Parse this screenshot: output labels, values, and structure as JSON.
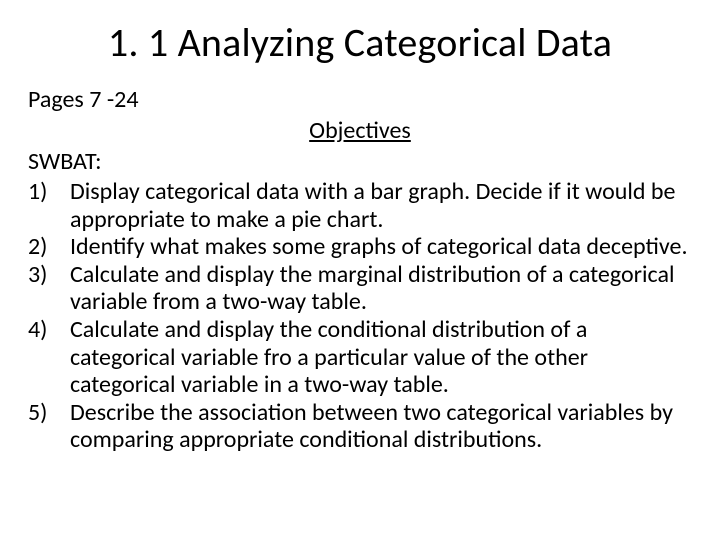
{
  "title": "1. 1 Analyzing Categorical Data",
  "pages": "Pages 7 -24",
  "subheading": "Objectives",
  "swbat": "SWBAT:",
  "objectives": [
    "Display categorical data with a bar graph.  Decide if it would be appropriate to make a pie chart.",
    "Identify what makes some graphs of categorical data deceptive.",
    "Calculate and display the marginal distribution of a categorical variable from a two-way table.",
    "Calculate and display the conditional distribution of a categorical variable fro a particular value of the other categorical variable in a two-way table.",
    "Describe the association between two categorical variables by comparing appropriate conditional distributions."
  ]
}
